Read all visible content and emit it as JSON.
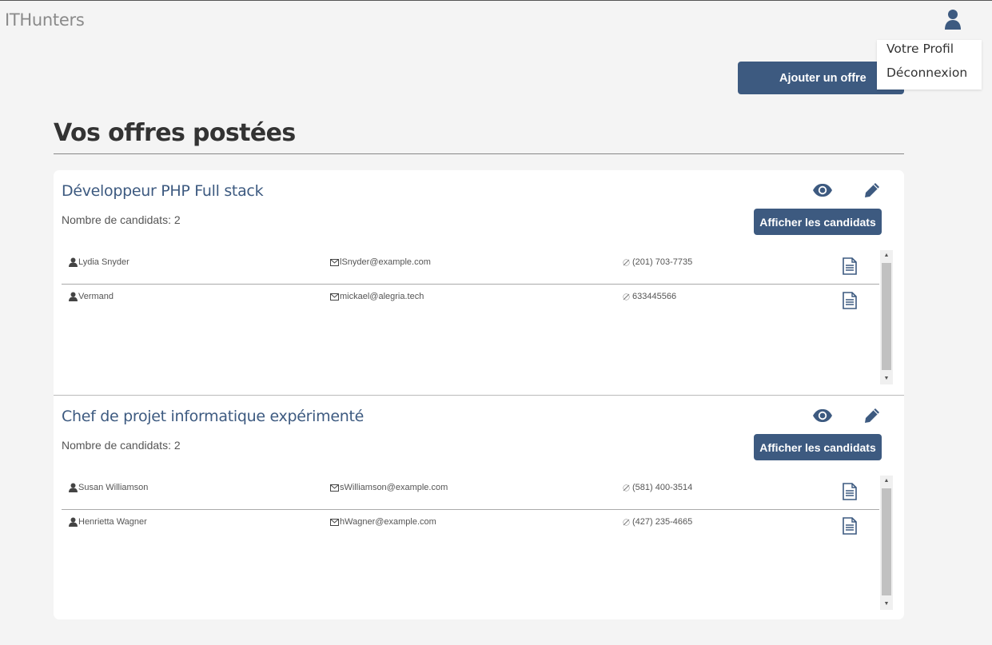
{
  "header": {
    "brand": "ITHunters",
    "user_icon": "user-icon",
    "menu": {
      "profile": "Votre Profil",
      "logout": "Déconnexion"
    }
  },
  "actions": {
    "add_offer": "Ajouter un offre"
  },
  "page": {
    "title": "Vos offres postées"
  },
  "colors": {
    "primary": "#3d5a80",
    "background": "#f4f4f4"
  },
  "offers": [
    {
      "title": "Développeur PHP Full stack",
      "count_label": "Nombre de candidats: 2",
      "show_candidates": "Afficher les candidats",
      "candidates": [
        {
          "name": "Lydia Snyder",
          "email": "lSnyder@example.com",
          "phone": "(201) 703-7735"
        },
        {
          "name": "Vermand",
          "email": "mickael@alegria.tech",
          "phone": "633445566"
        }
      ]
    },
    {
      "title": "Chef de projet informatique expérimenté",
      "count_label": "Nombre de candidats: 2",
      "show_candidates": "Afficher les candidats",
      "candidates": [
        {
          "name": "Susan Williamson",
          "email": "sWilliamson@example.com",
          "phone": "(581) 400-3514"
        },
        {
          "name": "Henrietta Wagner",
          "email": "hWagner@example.com",
          "phone": "(427) 235-4665"
        }
      ]
    }
  ]
}
